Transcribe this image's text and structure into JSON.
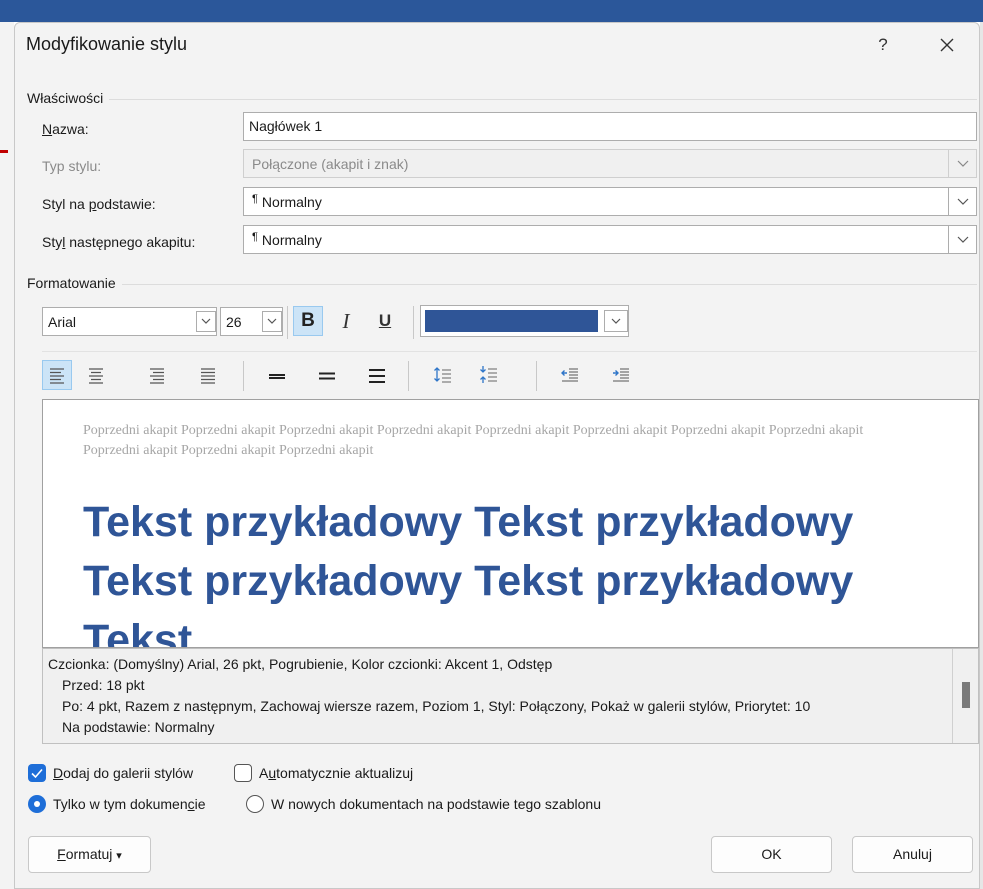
{
  "dialog": {
    "title": "Modyfikowanie stylu",
    "help_label": "?"
  },
  "properties": {
    "group_label": "Właściwości",
    "name_label_pre": "",
    "name_label_accel": "N",
    "name_label_post": "azwa:",
    "name_value": "Nagłówek 1",
    "type_label": "Typ stylu:",
    "type_value": "Połączone (akapit i znak)",
    "based_label_pre": "Styl na ",
    "based_label_accel": "p",
    "based_label_post": "odstawie:",
    "based_value": "Normalny",
    "next_label_pre": "Sty",
    "next_label_accel": "l",
    "next_label_post": " następnego akapitu:",
    "next_value": "Normalny",
    "pilcrow": "¶"
  },
  "formatting": {
    "group_label": "Formatowanie",
    "font_name": "Arial",
    "font_size": "26",
    "bold": "B",
    "italic": "I",
    "underline": "U",
    "font_color": "#2f5597"
  },
  "preview": {
    "previous_paragraph": "Poprzedni akapit Poprzedni akapit Poprzedni akapit Poprzedni akapit Poprzedni akapit Poprzedni akapit Poprzedni akapit Poprzedni akapit Poprzedni akapit Poprzedni akapit Poprzedni akapit",
    "sample_text": "Tekst przykładowy Tekst przykładowy Tekst przykładowy Tekst przykładowy Tekst"
  },
  "description": {
    "line1": "Czcionka: (Domyślny) Arial, 26 pkt, Pogrubienie, Kolor czcionki: Akcent 1, Odstęp",
    "line2": "Przed:  18 pkt",
    "line3": "Po:  4 pkt, Razem z następnym, Zachowaj wiersze razem, Poziom 1, Styl: Połączony, Pokaż w galerii stylów, Priorytet: 10",
    "line4": "Na podstawie: Normalny"
  },
  "options": {
    "add_gallery_accel": "D",
    "add_gallery_rest": "odaj do galerii stylów",
    "add_gallery_checked": true,
    "auto_update_pre": "A",
    "auto_update_accel": "u",
    "auto_update_post": "tomatycznie aktualizuj",
    "auto_update_checked": false,
    "only_doc_pre": "Tylko w tym dokumen",
    "only_doc_accel": "c",
    "only_doc_post": "ie",
    "only_doc_selected": true,
    "new_docs": "W nowych dokumentach na podstawie tego szablonu",
    "new_docs_selected": false
  },
  "buttons": {
    "format_accel": "F",
    "format_rest": "ormatuj",
    "format_arrow": "▾",
    "ok": "OK",
    "cancel": "Anuluj"
  }
}
